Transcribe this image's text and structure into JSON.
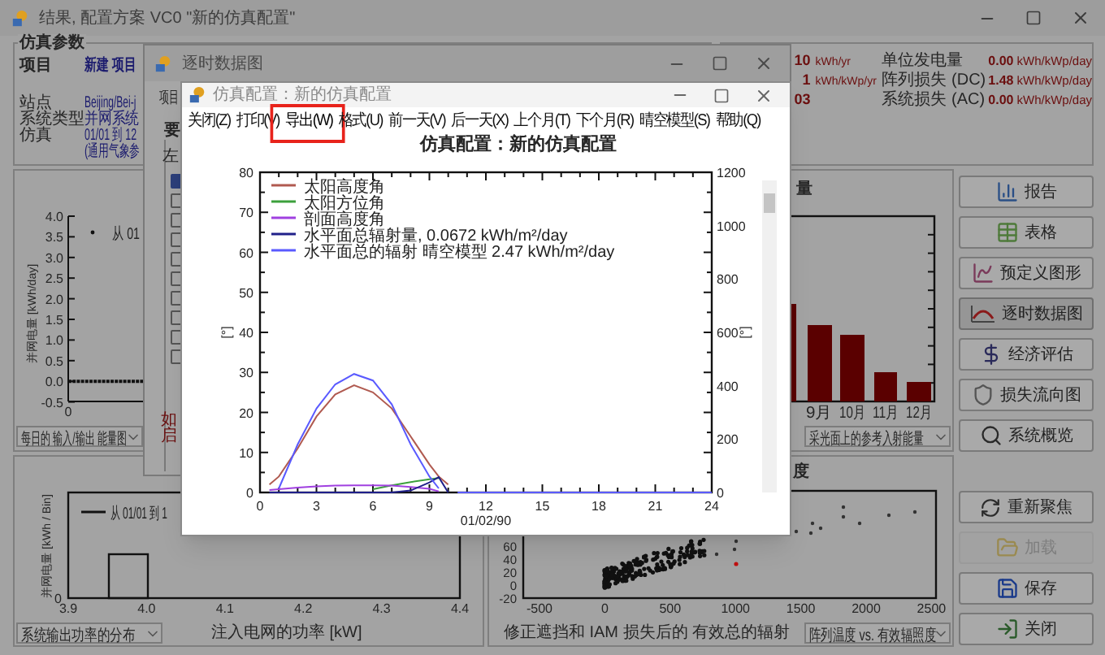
{
  "main_window": {
    "title": "结果, 配置方案 VC0 \"新的仿真配置\""
  },
  "simulation_parameters": {
    "heading": "仿真参数",
    "project_label": "项目",
    "project_value": "新建 项目",
    "rows": [
      {
        "label": "站点",
        "value": "Beijing/Bei-j"
      },
      {
        "label": "系统类型",
        "value": "并网系统"
      },
      {
        "label": "仿真",
        "value": "01/01 到 12"
      }
    ],
    "note": "(通用气象参"
  },
  "main_results": {
    "left_rows": [
      {
        "value": "10",
        "unit": "kWh/yr"
      },
      {
        "value": "1",
        "unit": "kWh/kWp/yr"
      },
      {
        "value": "03"
      }
    ],
    "right_rows": [
      {
        "label": "单位发电量",
        "value": "0.00",
        "unit": "kWh/kWp/day"
      },
      {
        "label": "阵列损失 (DC)",
        "value": "1.48",
        "unit": "kWh/kWp/day"
      },
      {
        "label": "系统损失 (AC)",
        "value": "0.00",
        "unit": "kWh/kWp/day"
      }
    ]
  },
  "daily_chart": {
    "ylabel": "并网电量 [kWh/day]",
    "yticks": [
      "4.0",
      "3.5",
      "3.0",
      "2.5",
      "2.0",
      "1.5",
      "1.0",
      "0.5",
      "0.0",
      "-0.5"
    ],
    "xtick": "0",
    "legend": "从 01",
    "dropdown": "每日的 输入/输出 能量图"
  },
  "monthly_chart": {
    "heading": "量",
    "months": [
      "9月",
      "10月",
      "11月",
      "12月"
    ],
    "dropdown": "采光面上的参考入射能量"
  },
  "power_distribution": {
    "legend": "从 01/01 到 1",
    "ylabel": "并网电量 [kWh / Bin]",
    "ytick": "0",
    "xticks": [
      "3.9",
      "4.0",
      "4.1",
      "4.2",
      "4.3",
      "4.4"
    ],
    "xlabel": "注入电网的功率 [kW]",
    "dropdown": "系统输出功率的分布"
  },
  "scatter_chart": {
    "heading": "度",
    "yticks": [
      "60",
      "40",
      "20",
      "0",
      "-20"
    ],
    "xticks": [
      "-500",
      "0",
      "500",
      "1000",
      "1500",
      "2000",
      "2500"
    ],
    "xlabel": "修正遮挡和 IAM 损失后的 有效总的辐射",
    "dropdown": "阵列温度 vs. 有效辐照度"
  },
  "side_buttons": [
    {
      "label": "报告",
      "selected": false,
      "disabled": false
    },
    {
      "label": "表格",
      "selected": false,
      "disabled": false
    },
    {
      "label": "预定义图形",
      "selected": false,
      "disabled": false
    },
    {
      "label": "逐时数据图",
      "selected": true,
      "disabled": false
    },
    {
      "label": "经济评估",
      "selected": false,
      "disabled": false
    },
    {
      "label": "损失流向图",
      "selected": false,
      "disabled": false
    },
    {
      "label": "系统概览",
      "selected": false,
      "disabled": false
    }
  ],
  "action_buttons": [
    {
      "label": "重新聚焦",
      "disabled": false
    },
    {
      "label": "加载",
      "disabled": true
    },
    {
      "label": "保存",
      "disabled": false
    },
    {
      "label": "关闭",
      "disabled": false
    }
  ],
  "hourly_window": {
    "title": "逐时数据图",
    "project_label": "项目",
    "group_label": "要",
    "side_label": "左",
    "checkboxes": [
      {
        "checked": true
      },
      {
        "checked": false
      },
      {
        "checked": false
      },
      {
        "checked": false
      },
      {
        "checked": false
      },
      {
        "checked": false
      },
      {
        "checked": false
      },
      {
        "checked": false
      },
      {
        "checked": false
      },
      {
        "checked": false
      }
    ],
    "warning_lines": [
      "如",
      "启"
    ]
  },
  "config_window": {
    "title": "仿真配置：新的仿真配置",
    "menu": [
      {
        "label": "关闭(Z)",
        "highlighted": false
      },
      {
        "label": "打印(V)",
        "highlighted": false
      },
      {
        "label": "导出(W)",
        "highlighted": true
      },
      {
        "label": "格式(U)",
        "highlighted": false
      },
      {
        "label": "前一天(V)",
        "highlighted": false
      },
      {
        "label": "后一天(X)",
        "highlighted": false
      },
      {
        "label": "上个月(T)",
        "highlighted": false
      },
      {
        "label": "下个月(R)",
        "highlighted": false
      },
      {
        "label": "晴空模型(S)",
        "highlighted": false
      },
      {
        "label": "帮助(Q)",
        "highlighted": false
      }
    ],
    "left_axis_label": "[°]",
    "right_axis_label": "[°]",
    "right_ticks": [
      "1200",
      "1000",
      "800",
      "600",
      "400",
      "200",
      "0"
    ],
    "chart_data": {
      "type": "line",
      "title": "仿真配置：新的仿真配置",
      "xlabel": "01/02/90",
      "xlim": [
        0,
        24
      ],
      "ylim": [
        0,
        80
      ],
      "xticks": [
        0,
        3,
        6,
        9,
        12,
        15,
        18,
        21,
        24
      ],
      "yticks": [
        0,
        10,
        20,
        30,
        40,
        50,
        60,
        70,
        80
      ],
      "legend": "upper left",
      "x": [
        0.5,
        1,
        2,
        3,
        4,
        5,
        6,
        7,
        8,
        9,
        9.5,
        10,
        10.5,
        12,
        15,
        18,
        21,
        24
      ],
      "series": [
        {
          "name": "太阳高度角",
          "color": "#b05a50",
          "values": [
            2,
            4,
            11,
            19,
            24.5,
            26.8,
            25,
            21,
            14,
            7,
            4,
            2,
            null,
            null,
            null,
            null,
            null,
            null
          ]
        },
        {
          "name": "太阳方位角",
          "color": "#3ca03c",
          "values": [
            null,
            null,
            null,
            null,
            null,
            null,
            0.8,
            1.8,
            2.6,
            3.3,
            3.6,
            null,
            null,
            null,
            null,
            null,
            null,
            null
          ]
        },
        {
          "name": "剖面高度角",
          "color": "#a040e0",
          "values": [
            0.6,
            0.8,
            1.2,
            1.5,
            1.7,
            1.8,
            1.8,
            1.7,
            1.4,
            0.9,
            0.3,
            null,
            null,
            null,
            null,
            null,
            null,
            null
          ]
        },
        {
          "name": "水平面总辐射量, 0.0672 kWh/m²/day",
          "color": "#20208a",
          "values": [
            0,
            0,
            0,
            0,
            0,
            0,
            0,
            0,
            0.5,
            2.5,
            3.8,
            0,
            null,
            null,
            null,
            null,
            null,
            null
          ]
        },
        {
          "name": "水平面总的辐射 晴空模型 2.47 kWh/m²/day",
          "color": "#5a5aff",
          "values": [
            null,
            1,
            12,
            21,
            27,
            29.6,
            28,
            22,
            12,
            4,
            1,
            null,
            0,
            0,
            0,
            0,
            0,
            0
          ]
        }
      ]
    }
  }
}
